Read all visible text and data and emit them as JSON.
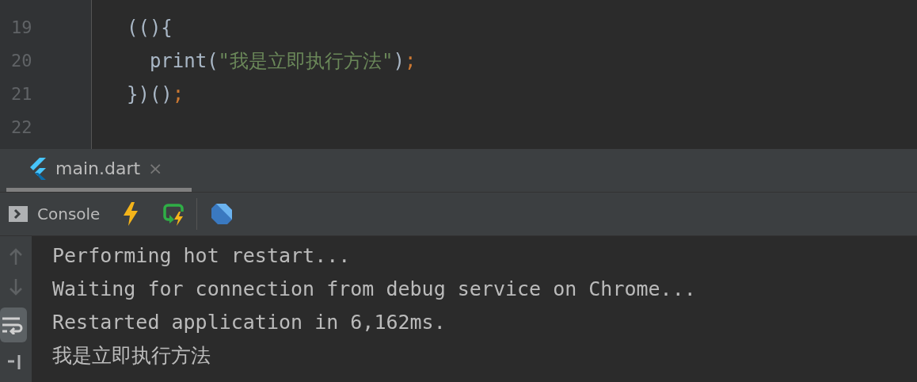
{
  "editor": {
    "lines": [
      {
        "number": "19",
        "tokens": [
          {
            "kind": "plain",
            "text": "((){"
          }
        ]
      },
      {
        "number": "20",
        "tokens": [
          {
            "kind": "plain",
            "text": "  print("
          },
          {
            "kind": "string",
            "text": "\"我是立即执行方法\""
          },
          {
            "kind": "plain",
            "text": ")"
          },
          {
            "kind": "semi",
            "text": ";"
          }
        ]
      },
      {
        "number": "21",
        "tokens": [
          {
            "kind": "plain",
            "text": "})()"
          },
          {
            "kind": "semi",
            "text": ";"
          }
        ]
      },
      {
        "number": "22"
      }
    ]
  },
  "tabs": [
    {
      "label": "main.dart",
      "selected": true,
      "close": "×"
    }
  ],
  "toolbar": {
    "console_label": "Console"
  },
  "console": {
    "lines": [
      "Performing hot restart...",
      "Waiting for connection from debug service on Chrome...",
      "Restarted application in 6,162ms.",
      "我是立即执行方法"
    ],
    "soft_wrap": {
      "selected": true
    }
  }
}
